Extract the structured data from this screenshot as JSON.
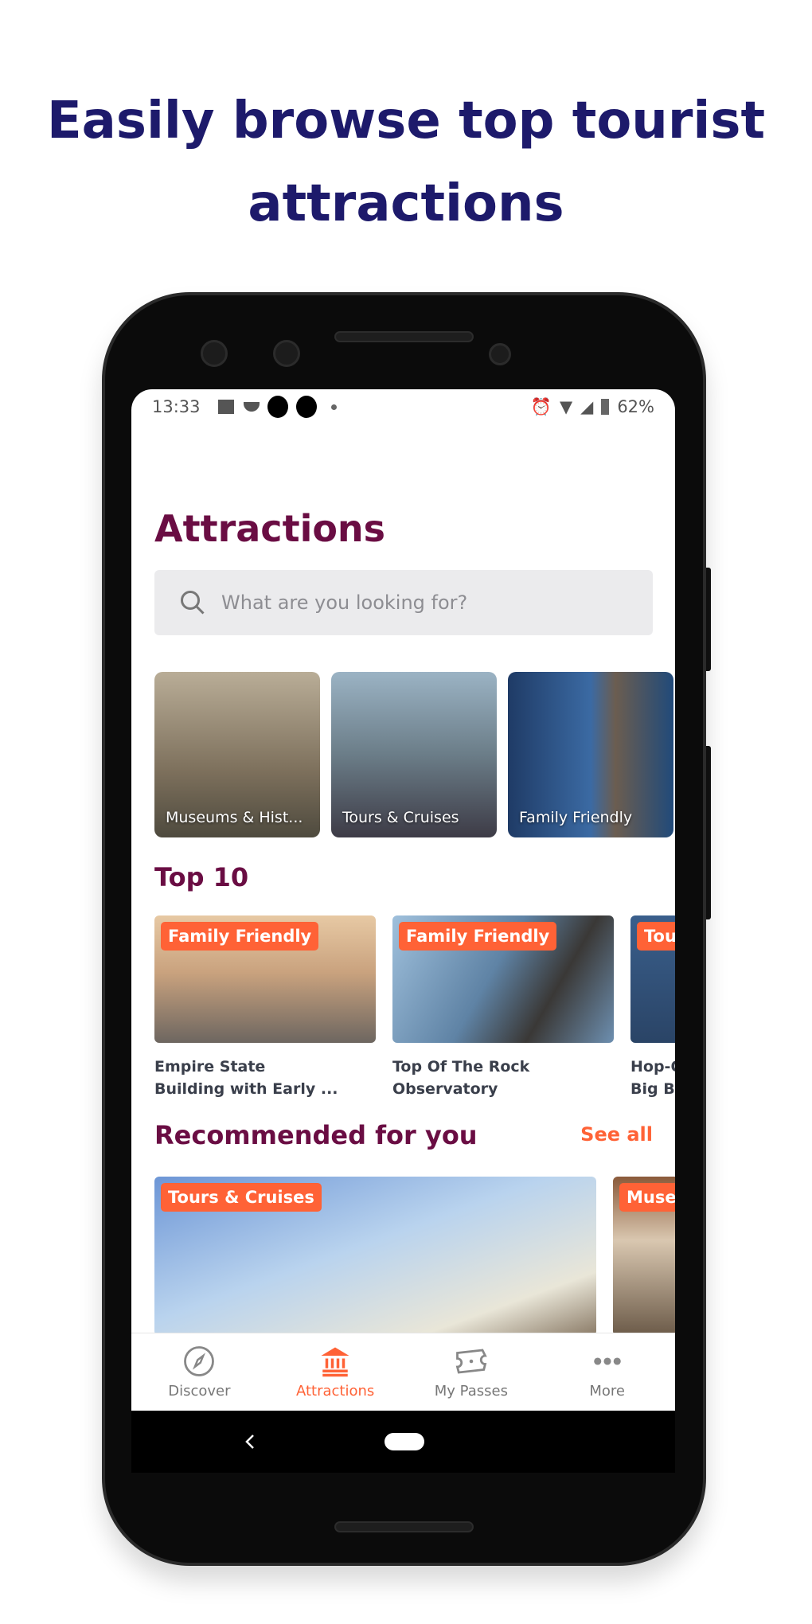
{
  "headline": {
    "line1": "Easily browse top tourist",
    "line2": "attractions"
  },
  "status_bar": {
    "time": "13:33",
    "battery": "62%"
  },
  "page": {
    "title": "Attractions"
  },
  "search": {
    "placeholder": "What are you looking for?"
  },
  "categories": [
    {
      "label": "Museums & Hist..."
    },
    {
      "label": "Tours & Cruises"
    },
    {
      "label": "Family Friendly"
    }
  ],
  "top10": {
    "heading": "Top 10",
    "items": [
      {
        "badge": "Family Friendly",
        "line1": "Empire State",
        "line2": "Building with Early ..."
      },
      {
        "badge": "Family Friendly",
        "line1": "Top Of The Rock",
        "line2": "Observatory"
      },
      {
        "badge": "Tour",
        "line1": "Hop-O",
        "line2": "Big Bu"
      }
    ]
  },
  "recommended": {
    "heading": "Recommended for you",
    "see_all": "See all",
    "items": [
      {
        "badge": "Tours & Cruises"
      },
      {
        "badge": "Museu"
      }
    ]
  },
  "tabs": [
    {
      "label": "Discover",
      "icon": "compass-icon"
    },
    {
      "label": "Attractions",
      "icon": "museum-icon",
      "active": true
    },
    {
      "label": "My Passes",
      "icon": "ticket-icon"
    },
    {
      "label": "More",
      "icon": "more-dots-icon"
    }
  ],
  "colors": {
    "headline": "#1d1a6b",
    "title": "#6a0d43",
    "accent": "#ff6236"
  }
}
